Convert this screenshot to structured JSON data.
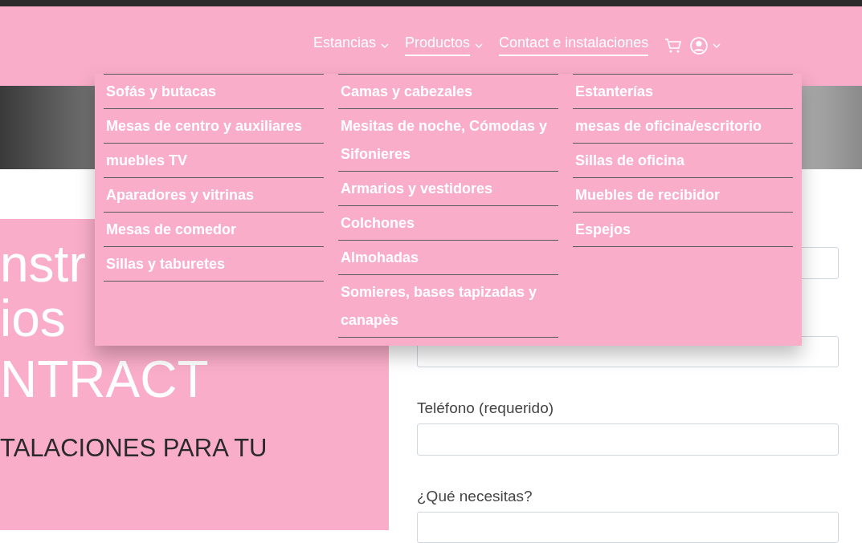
{
  "nav": [
    {
      "label": "Estancias",
      "kind": "dropdown",
      "underlined": false
    },
    {
      "label": "Productos",
      "kind": "dropdown",
      "underlined": true
    },
    {
      "label": "Contact e instalaciones",
      "kind": "link",
      "underlined": true
    }
  ],
  "dropdown": {
    "columns": [
      {
        "items": [
          "Sofás y butacas",
          "Mesas de centro y auxiliares",
          "muebles TV",
          "Aparadores y vitrinas",
          "Mesas de comedor",
          "Sillas y taburetes"
        ]
      },
      {
        "items": [
          "Camas y cabezales",
          "Mesitas de noche, Cómodas y Sifonieres",
          "Armarios y vestidores",
          "Colchones",
          "Almohadas",
          "Somieres, bases tapizadas y canapès"
        ]
      },
      {
        "items": [
          "Estanterías",
          "mesas de oficina/escritorio",
          "Sillas de oficina",
          "Muebles de recibidor",
          "Espejos"
        ]
      }
    ]
  },
  "hero": {
    "title_lines": [
      "nstr",
      "ios",
      "NTRACT"
    ],
    "subtitle": "TALACIONES PARA TU"
  },
  "form": {
    "fields": [
      {
        "kind": "field"
      },
      {
        "kind": "field"
      },
      {
        "kind": "label",
        "text": "Teléfono (requerido)"
      },
      {
        "kind": "field"
      },
      {
        "kind": "label",
        "text": "¿Qué necesitas?"
      },
      {
        "kind": "field"
      }
    ]
  }
}
